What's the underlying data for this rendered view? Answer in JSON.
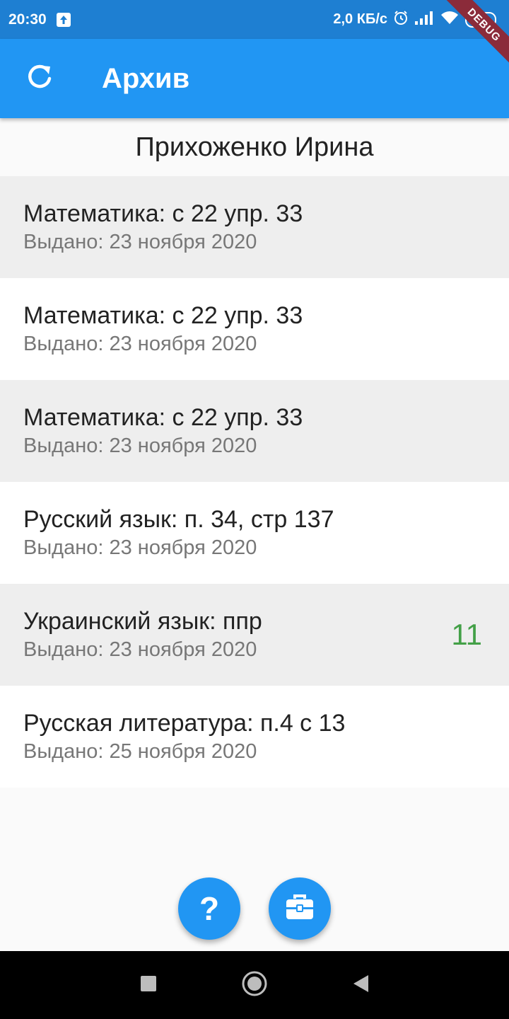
{
  "status_bar": {
    "time": "20:30",
    "speed": "2,0 КБ/с",
    "battery": "54",
    "icons": [
      "upload-icon",
      "alarm-icon",
      "signal-icon",
      "wifi-icon",
      "battery-icon"
    ]
  },
  "debug_banner": "DEBUG",
  "app_bar": {
    "title": "Архив",
    "refresh_icon": "refresh-icon"
  },
  "student_name": "Прихоженко Ирина",
  "homework": [
    {
      "title": "Математика: с 22 упр. 33",
      "issued": "Выдано: 23 ноября 2020",
      "grade": ""
    },
    {
      "title": "Математика: с 22 упр. 33",
      "issued": "Выдано: 23 ноября 2020",
      "grade": ""
    },
    {
      "title": "Математика: с 22 упр. 33",
      "issued": "Выдано: 23 ноября 2020",
      "grade": ""
    },
    {
      "title": "Русский язык: п. 34, стр 137",
      "issued": "Выдано: 23 ноября 2020",
      "grade": ""
    },
    {
      "title": "Украинский язык: ппр",
      "issued": "Выдано: 23 ноября 2020",
      "grade": "11"
    },
    {
      "title": "Русская литература: п.4 с 13",
      "issued": "Выдано: 25 ноября 2020",
      "grade": ""
    }
  ],
  "fabs": {
    "help_label": "?",
    "help_icon": "help-icon",
    "briefcase_icon": "briefcase-icon"
  },
  "colors": {
    "primary": "#2196f3",
    "status_bar": "#1e7fd2",
    "grade": "#43a047",
    "row_shade": "#eeeeee"
  }
}
